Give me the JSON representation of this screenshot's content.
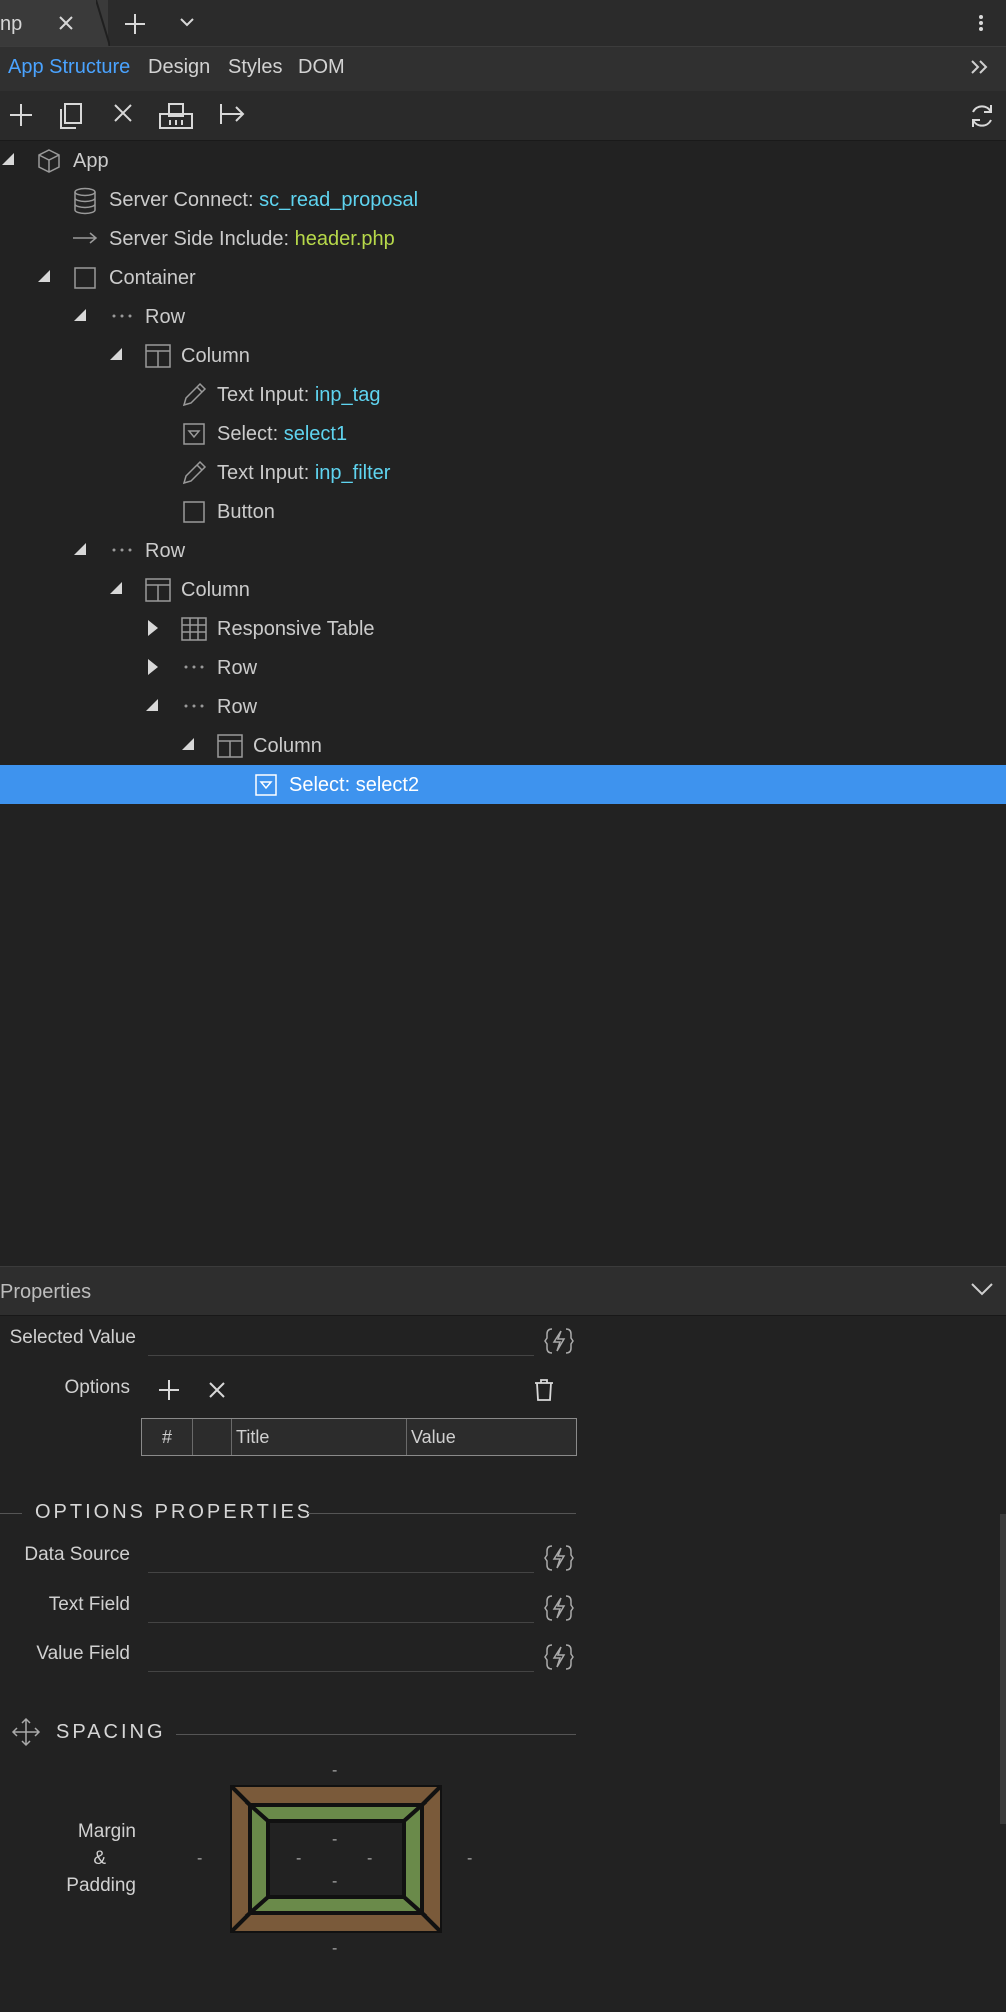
{
  "document_tab": {
    "label": "np"
  },
  "panel_tabs": [
    "App Structure",
    "Design",
    "Styles",
    "DOM"
  ],
  "tree": [
    {
      "label": "App",
      "value": ""
    },
    {
      "label": "Server Connect: ",
      "value": "sc_read_proposal"
    },
    {
      "label": "Server Side Include: ",
      "value": "header.php"
    },
    {
      "label": "Container",
      "value": ""
    },
    {
      "label": "Row",
      "value": ""
    },
    {
      "label": "Column",
      "value": ""
    },
    {
      "label": "Text Input: ",
      "value": "inp_tag"
    },
    {
      "label": "Select: ",
      "value": "select1"
    },
    {
      "label": "Text Input: ",
      "value": "inp_filter"
    },
    {
      "label": "Button",
      "value": ""
    },
    {
      "label": "Row",
      "value": ""
    },
    {
      "label": "Column",
      "value": ""
    },
    {
      "label": "Responsive Table",
      "value": ""
    },
    {
      "label": "Row",
      "value": ""
    },
    {
      "label": "Row",
      "value": ""
    },
    {
      "label": "Column",
      "value": ""
    },
    {
      "label": "Select: select2",
      "value": ""
    }
  ],
  "properties": {
    "title": "Properties",
    "selected_value_label": "Selected Value",
    "options_label": "Options",
    "options_table": {
      "col_num": "#",
      "col_title": "Title",
      "col_value": "Value"
    },
    "options_properties_title": "OPTIONS PROPERTIES",
    "data_source_label": "Data Source",
    "text_field_label": "Text Field",
    "value_field_label": "Value Field",
    "spacing_title": "SPACING",
    "margin_padding_label_1": "Margin",
    "margin_padding_label_2": "&",
    "margin_padding_label_3": "Padding",
    "spacing_placeholder": "-"
  },
  "colors": {
    "accent": "#4aa3ff",
    "selection": "#3e93ee",
    "value_cyan": "#5fd4f0",
    "value_green": "#b7d94a",
    "margin_brown": "#7a5a3a",
    "padding_green": "#6a8a4a"
  }
}
